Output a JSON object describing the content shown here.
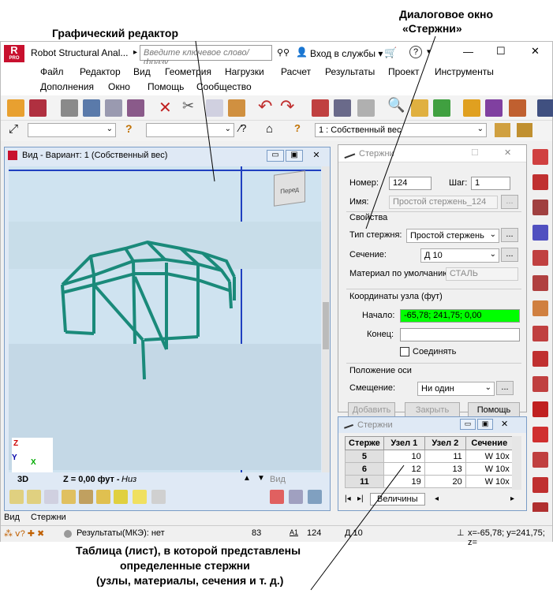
{
  "annotations": {
    "graphic_editor": "Графический редактор",
    "dialog_line1": "Диалоговое окно",
    "dialog_line2": "«Стержни»",
    "table_line1": "Таблица (лист), в которой представлены",
    "table_line2": "определенные стержни",
    "table_line3": "(узлы, материалы, сечения и т. д.)"
  },
  "app": {
    "logo": "R",
    "logo_sub": "PRO",
    "title": "Robot Structural Anal...",
    "search_placeholder": "Введите ключевое слово/фразу",
    "login": "Вход в службы",
    "minimize": "—",
    "maximize": "☐",
    "close": "✕"
  },
  "menu": {
    "row1": [
      "Файл",
      "Редактор",
      "Вид",
      "Геометрия",
      "Нагрузки",
      "Расчет",
      "Результаты",
      "Проект",
      "Инструменты"
    ],
    "row2": [
      "Дополнения",
      "Окно",
      "Помощь",
      "Сообщество"
    ]
  },
  "toolbar2": {
    "load_case": "1 : Собственный вес"
  },
  "view": {
    "title": "Вид - Вариант: 1 (Собственный вес)",
    "cube_label": "Перед",
    "mode": "3D",
    "z_level": "Z = 0,00 фут - ",
    "z_level_suffix": "Низ",
    "tab_hint": "Вид"
  },
  "dialog": {
    "title": "Стержни",
    "number_label": "Номер:",
    "number_value": "124",
    "step_label": "Шаг:",
    "step_value": "1",
    "name_label": "Имя:",
    "name_value": "Простой стержень_124",
    "props_header": "Свойства",
    "type_label": "Тип стержня:",
    "type_value": "Простой стержень",
    "section_label": "Сечение:",
    "section_value": "Д 10",
    "material_label": "Материал по умолчанию:",
    "material_value": "СТАЛЬ",
    "coords_header": "Координаты узла (фут)",
    "start_label": "Начало:",
    "start_value": "-65,78; 241,75; 0,00",
    "end_label": "Конец:",
    "end_value": "",
    "connect_label": "Соединять",
    "axis_header": "Положение оси",
    "offset_label": "Смещение:",
    "offset_value": "Ни один",
    "add_btn": "Добавить",
    "close_btn": "Закрыть",
    "help_btn": "Помощь",
    "ellipsis": "..."
  },
  "table": {
    "title": "Стержни",
    "headers": [
      "Стерже",
      "Узел 1",
      "Узел 2",
      "Сечение"
    ],
    "rows": [
      [
        "5",
        "10",
        "11",
        "W 10x"
      ],
      [
        "6",
        "12",
        "13",
        "W 10x"
      ],
      [
        "11",
        "19",
        "20",
        "W 10x"
      ]
    ],
    "tab": "Величины"
  },
  "bottom_tabs": [
    "Вид",
    "Стержни"
  ],
  "status": {
    "results": "Результаты(МКЭ): нет",
    "n1": "83",
    "n2": "124",
    "section": "Д 10",
    "coords": "x=-65,78; y=241,75; z="
  },
  "colors": {
    "structure": "#1a8a7a",
    "start_field": "#00ff00",
    "logo": "#c8102e"
  }
}
